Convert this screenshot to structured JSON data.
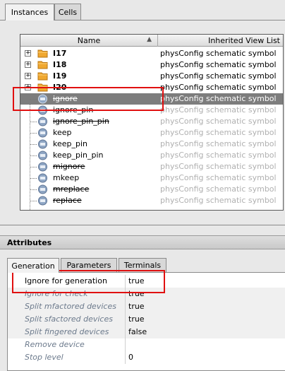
{
  "top_tabs": [
    {
      "label": "Instances",
      "active": true
    },
    {
      "label": "Cells",
      "active": false
    }
  ],
  "tree": {
    "col_name": "Name",
    "col_view": "Inherited View List",
    "rows": [
      {
        "name": "I17",
        "view": "physConfig schematic symbol",
        "type": "folder"
      },
      {
        "name": "I18",
        "view": "physConfig schematic symbol",
        "type": "folder"
      },
      {
        "name": "I19",
        "view": "physConfig schematic symbol",
        "type": "folder"
      },
      {
        "name": "I20",
        "view": "physConfig schematic symbol",
        "type": "folder"
      },
      {
        "name": "ignore",
        "view": "physConfig schematic symbol",
        "type": "instance"
      },
      {
        "name": "ignore_pin",
        "view": "physConfig schematic symbol",
        "type": "instance"
      },
      {
        "name": "ignore_pin_pin",
        "view": "physConfig schematic symbol",
        "type": "instance"
      },
      {
        "name": "keep",
        "view": "physConfig schematic symbol",
        "type": "instance"
      },
      {
        "name": "keep_pin",
        "view": "physConfig schematic symbol",
        "type": "instance"
      },
      {
        "name": "keep_pin_pin",
        "view": "physConfig schematic symbol",
        "type": "instance"
      },
      {
        "name": "mignore",
        "view": "physConfig schematic symbol",
        "type": "instance"
      },
      {
        "name": "mkeep",
        "view": "physConfig schematic symbol",
        "type": "instance"
      },
      {
        "name": "mreplace",
        "view": "physConfig schematic symbol",
        "type": "instance"
      },
      {
        "name": "replace",
        "view": "physConfig schematic symbol",
        "type": "instance"
      }
    ]
  },
  "attributes": {
    "title": "Attributes",
    "tabs": [
      "Generation",
      "Parameters",
      "Terminals"
    ],
    "rows": [
      {
        "label": "Ignore for generation",
        "value": "true"
      },
      {
        "label": "Ignore for check",
        "value": "true"
      },
      {
        "label": "Split mfactored devices",
        "value": "true"
      },
      {
        "label": "Split sfactored devices",
        "value": "true"
      },
      {
        "label": "Split fingered devices",
        "value": "false"
      },
      {
        "label": "Remove device",
        "value": ""
      },
      {
        "label": "Stop level",
        "value": "0"
      }
    ]
  },
  "colors": {
    "selection": "#7d7d7d",
    "highlight_box": "#e01010",
    "disabled_text": "#b0b0b0",
    "italic_label": "#6c7a8c",
    "folder": "#f0a830",
    "instance_icon": "#8fa6c4"
  }
}
